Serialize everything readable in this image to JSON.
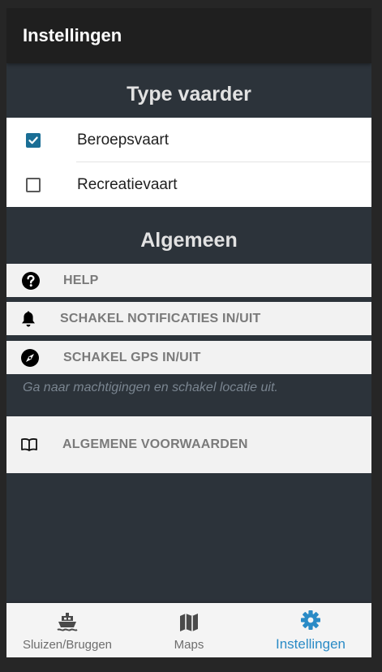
{
  "header": {
    "title": "Instellingen"
  },
  "vaarder": {
    "title": "Type vaarder",
    "options": [
      {
        "label": "Beroepsvaart",
        "checked": true
      },
      {
        "label": "Recreatievaart",
        "checked": false
      }
    ]
  },
  "algemeen": {
    "title": "Algemeen",
    "items": [
      {
        "label": "HELP",
        "icon": "question-circle-icon"
      },
      {
        "label": "SCHAKEL NOTIFICATIES IN/UIT",
        "icon": "bell-icon"
      },
      {
        "label": "SCHAKEL GPS IN/UIT",
        "icon": "compass-icon"
      }
    ],
    "gps_hint": "Ga naar machtigingen en schakel locatie uit.",
    "terms": {
      "label": "ALGEMENE VOORWAARDEN",
      "icon": "book-icon"
    }
  },
  "tabs": [
    {
      "label": "Sluizen/Bruggen",
      "icon": "ship-icon",
      "active": false
    },
    {
      "label": "Maps",
      "icon": "map-icon",
      "active": false
    },
    {
      "label": "Instellingen",
      "icon": "gear-icon",
      "active": true
    }
  ],
  "colors": {
    "accent": "#2a8bc6",
    "checkbox": "#1a6e95",
    "header_bg": "#1f1f1f",
    "content_bg": "#2c333a",
    "tabbar_bg": "#f4f4f4"
  }
}
